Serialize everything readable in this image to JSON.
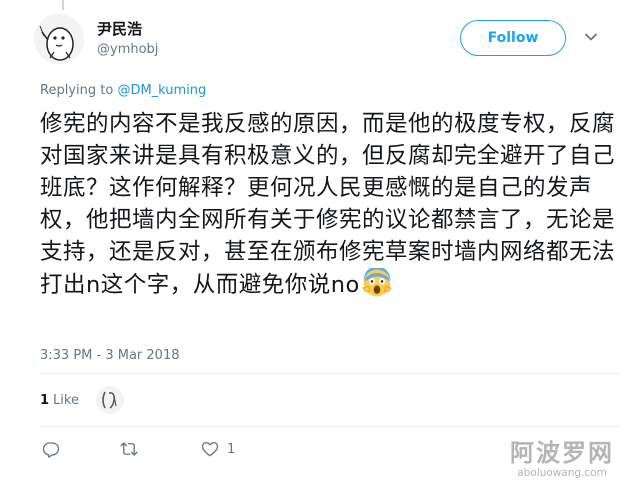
{
  "user": {
    "name": "尹民浩",
    "handle": "@ymhobj"
  },
  "follow_label": "Follow",
  "reply_context": {
    "prefix": "Replying to ",
    "mention": "@DM_kuming"
  },
  "tweet": {
    "text": "修宪的内容不是我反感的原因，而是他的极度专权，反腐对国家来讲是具有积极意义的，但反腐却完全避开了自己班底？这作何解释？更何况人民更感慨的是自己的发声权，他把墙内全网所有关于修宪的议论都禁言了，无论是支持，还是反对，甚至在颁布修宪草案时墙内网络都无法打出n这个字，从而避免你说no",
    "emoji": "face-screaming-in-fear"
  },
  "timestamp": "3:33 PM - 3 Mar 2018",
  "likes": {
    "count": "1",
    "label": "Like"
  },
  "actions": {
    "reply_icon": "reply-icon",
    "retweet_icon": "retweet-icon",
    "like_icon": "heart-icon",
    "like_count": "1"
  },
  "watermark": {
    "title": "阿波罗网",
    "url": "aboluowang.com"
  },
  "colors": {
    "accent": "#1da1f2",
    "mention": "#1b95e0",
    "muted": "#657786",
    "text": "#14171a",
    "divider": "#e6ecf0"
  }
}
